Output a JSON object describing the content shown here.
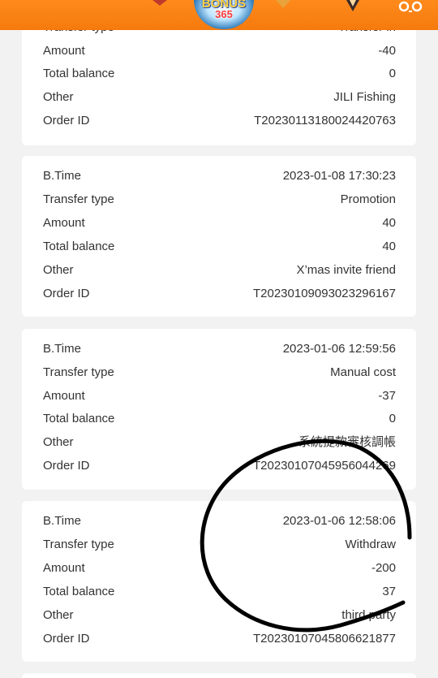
{
  "header": {
    "logo_line1": "BONUS",
    "logo_line2": "365",
    "corner_icon": "chat-bubble-icon"
  },
  "records": [
    {
      "rows": [
        {
          "label": "Transfer type",
          "value": "Transfer in"
        },
        {
          "label": "Amount",
          "value": "-40"
        },
        {
          "label": "Total balance",
          "value": "0"
        },
        {
          "label": "Other",
          "value": "JILI Fishing"
        },
        {
          "label": "Order ID",
          "value": "T20230113180024420763"
        }
      ]
    },
    {
      "rows": [
        {
          "label": "B.Time",
          "value": "2023-01-08 17:30:23"
        },
        {
          "label": "Transfer type",
          "value": "Promotion"
        },
        {
          "label": "Amount",
          "value": "40"
        },
        {
          "label": "Total balance",
          "value": "40"
        },
        {
          "label": "Other",
          "value": "X’mas invite friend"
        },
        {
          "label": "Order ID",
          "value": "T20230109093023296167"
        }
      ]
    },
    {
      "rows": [
        {
          "label": "B.Time",
          "value": "2023-01-06 12:59:56"
        },
        {
          "label": "Transfer type",
          "value": "Manual cost"
        },
        {
          "label": "Amount",
          "value": "-37"
        },
        {
          "label": "Total balance",
          "value": "0"
        },
        {
          "label": "Other",
          "value": "系統提款審核調帳"
        },
        {
          "label": "Order ID",
          "value": "T20230107045956044269"
        }
      ]
    },
    {
      "rows": [
        {
          "label": "B.Time",
          "value": "2023-01-06 12:58:06"
        },
        {
          "label": "Transfer type",
          "value": "Withdraw"
        },
        {
          "label": "Amount",
          "value": "-200"
        },
        {
          "label": "Total balance",
          "value": "37"
        },
        {
          "label": "Other",
          "value": "third party"
        },
        {
          "label": "Order ID",
          "value": "T20230107045806621877"
        }
      ]
    }
  ],
  "colors": {
    "header": "#f57a0d",
    "background": "#f2f2f2",
    "card": "#ffffff",
    "annotation_ink": "#000000"
  }
}
